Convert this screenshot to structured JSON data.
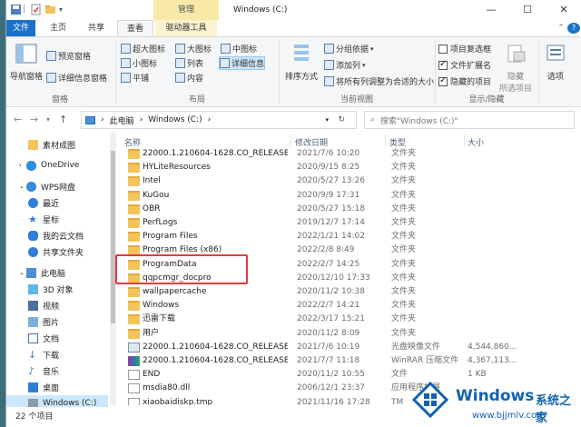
{
  "titlebar": {
    "context_tab": "管理",
    "window_title": "Windows (C:)",
    "min": "—",
    "max": "☐",
    "close": "✕"
  },
  "tabs": [
    {
      "label": "文件",
      "key": "file"
    },
    {
      "label": "主页",
      "key": "home"
    },
    {
      "label": "共享",
      "key": "share"
    },
    {
      "label": "查看",
      "key": "view"
    },
    {
      "label": "驱动器工具",
      "key": "drive"
    }
  ],
  "ribbon": {
    "nav_pane": "导航窗格",
    "preview_pane": "预览窗格",
    "details_pane": "详细信息窗格",
    "pane_group": "窗格",
    "xl_icons": "超大图标",
    "large_icons": "大图标",
    "medium_icons": "中图标",
    "small_icons": "小图标",
    "list": "列表",
    "details": "详细信息",
    "tiles": "平铺",
    "content": "内容",
    "layout_group": "布局",
    "sort_by": "排序方式",
    "group_by": "分组依据",
    "add_columns": "添加列",
    "size_all_columns": "将所有列调整为合适的大小",
    "current_view_group": "当前视图",
    "item_checkboxes": "项目复选框",
    "file_extensions": "文件扩展名",
    "hidden_items": "隐藏的项目",
    "hide": "隐藏",
    "hide_selected": "所选项目",
    "options": "选项",
    "showhide_group": "显示/隐藏"
  },
  "address": {
    "crumbs": [
      "此电脑",
      "Windows (C:)"
    ],
    "search_placeholder": "搜索\"Windows (C:)\""
  },
  "nav": [
    {
      "label": "素材成图",
      "icon": "folder-icon"
    },
    {
      "label": "OneDrive",
      "icon": "cloud-icon"
    },
    {
      "label": "WPS网盘",
      "icon": "cloud-icon"
    },
    {
      "label": "最近",
      "icon": "clock-icon"
    },
    {
      "label": "星标",
      "icon": "star-icon"
    },
    {
      "label": "我的云文档",
      "icon": "cloud-doc-icon"
    },
    {
      "label": "共享文件夹",
      "icon": "shared-folder-icon"
    },
    {
      "label": "此电脑",
      "icon": "computer-icon"
    },
    {
      "label": "3D 对象",
      "icon": "cube-icon"
    },
    {
      "label": "视频",
      "icon": "video-icon"
    },
    {
      "label": "图片",
      "icon": "picture-icon"
    },
    {
      "label": "文档",
      "icon": "document-icon"
    },
    {
      "label": "下载",
      "icon": "download-icon"
    },
    {
      "label": "音乐",
      "icon": "music-icon"
    },
    {
      "label": "桌面",
      "icon": "desktop-icon"
    },
    {
      "label": "Windows (C:)",
      "icon": "drive-icon"
    }
  ],
  "columns": {
    "name": "名称",
    "date": "修改日期",
    "type": "类型",
    "size": "大小"
  },
  "files": [
    {
      "name": "22000.1.210604-1628.CO_RELEASE_SV...",
      "date": "2021/7/6 10:20",
      "type": "文件夹",
      "size": "",
      "kind": "folder"
    },
    {
      "name": "HYLiteResources",
      "date": "2020/9/15 8:25",
      "type": "文件夹",
      "size": "",
      "kind": "folder"
    },
    {
      "name": "Intel",
      "date": "2020/5/27 13:26",
      "type": "文件夹",
      "size": "",
      "kind": "folder"
    },
    {
      "name": "KuGou",
      "date": "2020/9/9 17:31",
      "type": "文件夹",
      "size": "",
      "kind": "folder"
    },
    {
      "name": "OBR",
      "date": "2020/5/27 15:18",
      "type": "文件夹",
      "size": "",
      "kind": "folder"
    },
    {
      "name": "PerfLogs",
      "date": "2019/12/7 17:14",
      "type": "文件夹",
      "size": "",
      "kind": "folder"
    },
    {
      "name": "Program Files",
      "date": "2022/1/21 14:02",
      "type": "文件夹",
      "size": "",
      "kind": "folder"
    },
    {
      "name": "Program Files (x86)",
      "date": "2022/2/8 8:49",
      "type": "文件夹",
      "size": "",
      "kind": "folder"
    },
    {
      "name": "ProgramData",
      "date": "2022/2/7 14:25",
      "type": "文件夹",
      "size": "",
      "kind": "folder"
    },
    {
      "name": "qqpcmgr_docpro",
      "date": "2020/12/10 17:33",
      "type": "文件夹",
      "size": "",
      "kind": "folder"
    },
    {
      "name": "wallpapercache",
      "date": "2020/11/2 10:38",
      "type": "文件夹",
      "size": "",
      "kind": "folder"
    },
    {
      "name": "Windows",
      "date": "2022/2/7 14:21",
      "type": "文件夹",
      "size": "",
      "kind": "folder"
    },
    {
      "name": "迅雷下载",
      "date": "2022/3/17 15:21",
      "type": "文件夹",
      "size": "",
      "kind": "folder"
    },
    {
      "name": "用户",
      "date": "2020/11/2 8:09",
      "type": "文件夹",
      "size": "",
      "kind": "folder"
    },
    {
      "name": "22000.1.210604-1628.CO_RELEASE_SV...",
      "date": "2021/7/6 10:19",
      "type": "光盘映像文件",
      "size": "4,544,860...",
      "kind": "iso"
    },
    {
      "name": "22000.1.210604-1628.CO_RELEASE_SV...",
      "date": "2021/7/7 11:18",
      "type": "WinRAR 压缩文件",
      "size": "4,367,113...",
      "kind": "rar"
    },
    {
      "name": "END",
      "date": "2020/11/2 10:55",
      "type": "文件",
      "size": "1 KB",
      "kind": "doc"
    },
    {
      "name": "msdia80.dll",
      "date": "2006/12/1 23:37",
      "type": "应用程序扩展",
      "size": "",
      "kind": "doc"
    },
    {
      "name": "xiaobaidiskp.tmp",
      "date": "2021/11/16 17:28",
      "type": "TM",
      "size": "",
      "kind": "doc"
    }
  ],
  "status": "22 个项目",
  "watermark": {
    "brand": "Windows",
    "suffix": "系统之家",
    "url": "www.bjjmlv.com"
  }
}
